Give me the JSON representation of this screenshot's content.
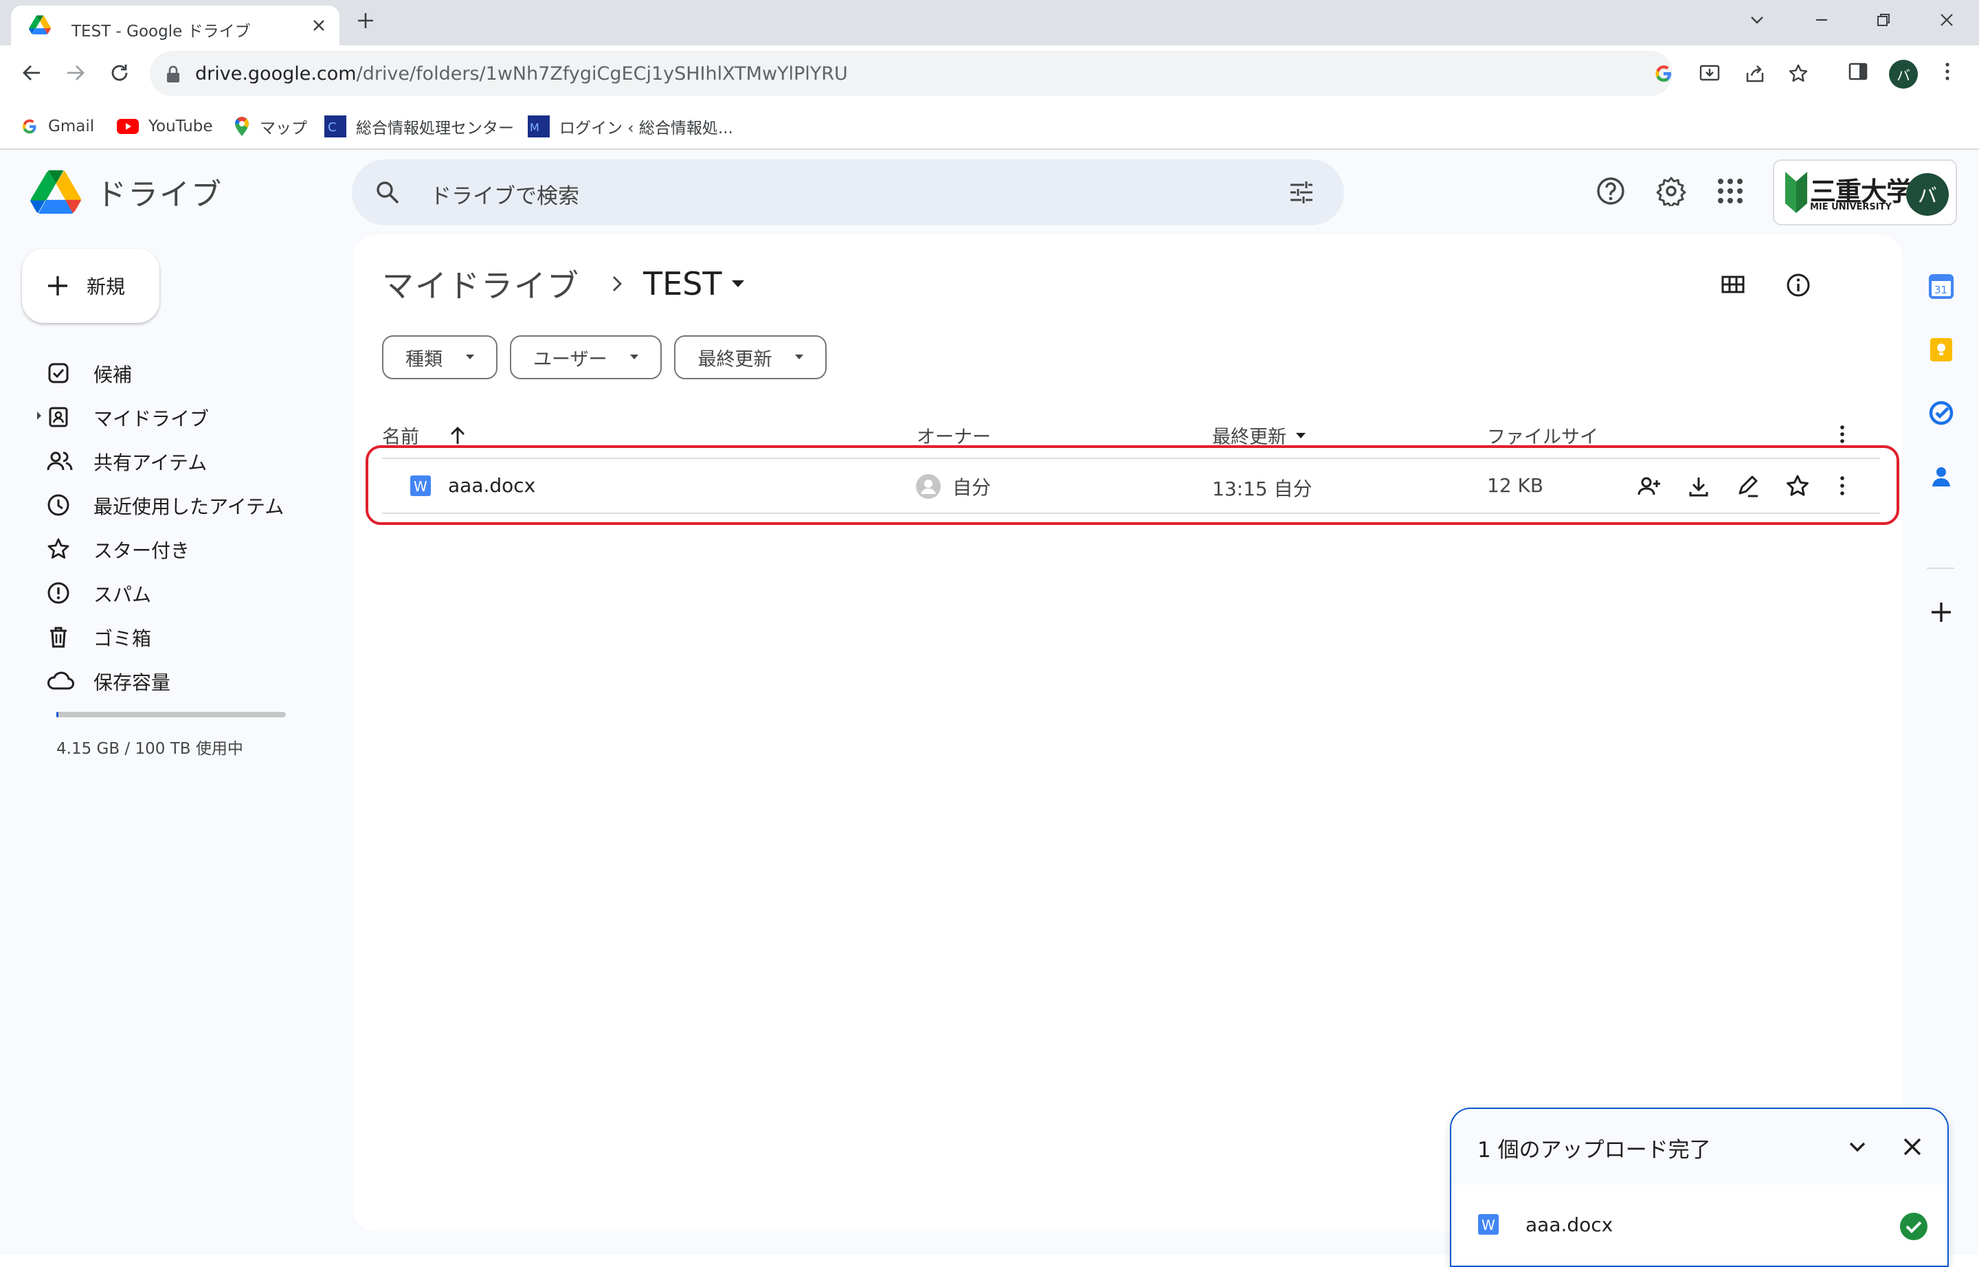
{
  "browser": {
    "tab_title": "TEST - Google ドライブ",
    "url_host": "drive.google.com",
    "url_path": "/drive/folders/1wNh7ZfygiCgECj1ySHIhlXTMwYlPlYRU",
    "profile_initial": "バ",
    "bookmarks": [
      {
        "label": "Gmail"
      },
      {
        "label": "YouTube"
      },
      {
        "label": "マップ"
      },
      {
        "label": "総合情報処理センター"
      },
      {
        "label": "ログイン ‹ 総合情報処..."
      }
    ]
  },
  "drive": {
    "product_name": "ドライブ",
    "search_placeholder": "ドライブで検索",
    "org_name_jp": "三重大学",
    "org_name_en": "MIE UNIVERSITY",
    "avatar_initial": "バ",
    "new_button": "新規",
    "nav": [
      {
        "label": "候補",
        "icon": "suggested-icon"
      },
      {
        "label": "マイドライブ",
        "icon": "my-drive-icon"
      },
      {
        "label": "共有アイテム",
        "icon": "shared-icon"
      },
      {
        "label": "最近使用したアイテム",
        "icon": "recent-icon"
      },
      {
        "label": "スター付き",
        "icon": "star-icon"
      },
      {
        "label": "スパム",
        "icon": "spam-icon"
      },
      {
        "label": "ゴミ箱",
        "icon": "trash-icon"
      },
      {
        "label": "保存容量",
        "icon": "cloud-icon"
      }
    ],
    "storage_text": "4.15 GB / 100 TB 使用中",
    "storage_used_fraction": 4.15e-05,
    "breadcrumb": {
      "root": "マイドライブ",
      "current": "TEST"
    },
    "filters": [
      "種類",
      "ユーザー",
      "最終更新"
    ],
    "columns": {
      "name": "名前",
      "owner": "オーナー",
      "modified": "最終更新",
      "size": "ファイルサイ"
    },
    "files": [
      {
        "name": "aaa.docx",
        "owner": "自分",
        "modified": "13:15 自分",
        "size": "12 KB",
        "type_badge": "W"
      }
    ],
    "upload_panel": {
      "title": "1 個のアップロード完了",
      "file_name": "aaa.docx",
      "type_badge": "W"
    }
  },
  "colors": {
    "accent": "#0b57d0",
    "highlight": "#e0202d",
    "word": "#4285f4",
    "success": "#1e8e3e"
  }
}
